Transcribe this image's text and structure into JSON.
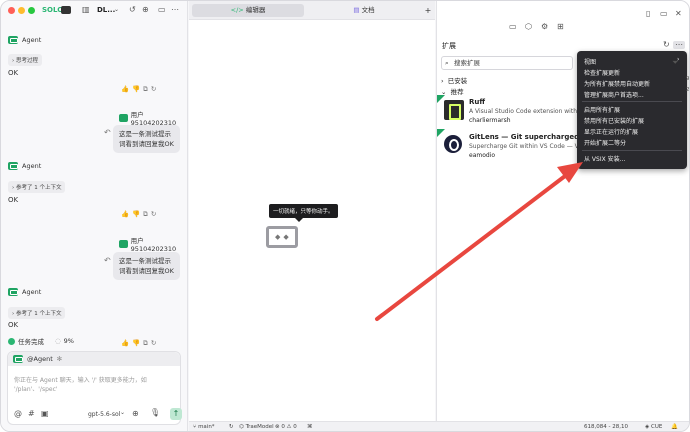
{
  "app": {
    "solo_label": "SOLO",
    "project_label": "DL..."
  },
  "chat": {
    "agent_name": "Agent",
    "thinking_chip": "思考过程",
    "ok_1": "OK",
    "user_1": "用户95104202310",
    "user_msg_1": "这是一条测试提示词看到请回复我OK",
    "agent_name_2": "Agent",
    "context_chip_1": "参考了 1 个上下文",
    "ok_2": "OK",
    "user_2": "用户95104202310",
    "user_msg_2": "这是一条测试提示词看到请回复我OK",
    "agent_name_3": "Agent",
    "context_chip_2": "参考了 1 个上下文",
    "ok_3": "OK",
    "task_done": "任务完成",
    "task_progress": "9%"
  },
  "composer": {
    "mention": "@Agent",
    "placeholder": "你正在与 Agent 聊天，输入 '/' 获取更多能力，如 '/plan'、'/spec'",
    "model": "gpt-5.6-sol",
    "send_icon": "arrow-up-icon"
  },
  "editor": {
    "tab_editor": "编辑器",
    "tab_docs": "文档",
    "tab_add": "+",
    "empty_message": "一切就绪，只等你动手。"
  },
  "extensions": {
    "title": "扩展",
    "search_value": "搜索扩展",
    "installed_label": "已安装",
    "recommended_label": "推荐",
    "items": [
      {
        "name": "Ruff",
        "desc": "A Visual Studio Code extension with sup",
        "publisher": "charliermarsh",
        "icon": "ruff-icon"
      },
      {
        "name": "GitLens — Git supercharged",
        "desc": "Supercharge Git within VS Code — Visual",
        "publisher": "eamodio",
        "icon": "gitlens-icon"
      }
    ]
  },
  "menu": {
    "items": [
      "视图",
      "检查扩展更新",
      "为所有扩展禁用自动更新",
      "管理扩展商户首选项...",
      "启用所有扩展",
      "禁用所有已安装的扩展",
      "显示正在运行的扩展",
      "开始扩展二等分",
      "从 VSIX 安装..."
    ]
  },
  "statusbar": {
    "branch": "main*",
    "model": "TraeModel",
    "problems": "0",
    "warnings": "0",
    "cursor": "618,084 - 28,10",
    "lang": "CUE"
  },
  "annotation": {
    "arrow_color": "#e8473f"
  }
}
